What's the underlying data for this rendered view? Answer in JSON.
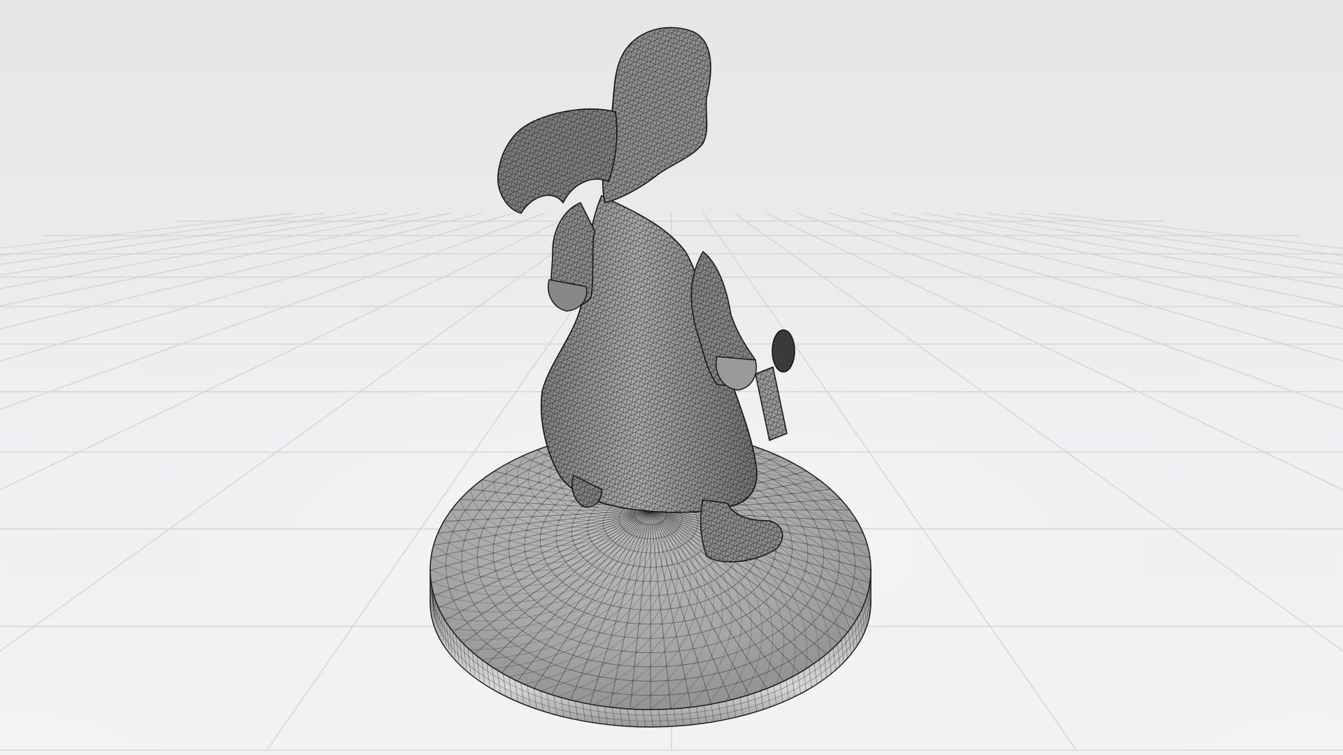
{
  "scene": {
    "background_top": "#e6e7e9",
    "background_floor": "#f1f1f2",
    "grid_color": "#d2d4d7",
    "mesh_fill": "#9a9a9a",
    "mesh_wire_color": "#1a1a1a",
    "render_mode": "wireframe-shaded",
    "object": "figurine-miniature",
    "has_floor_grid": true
  }
}
